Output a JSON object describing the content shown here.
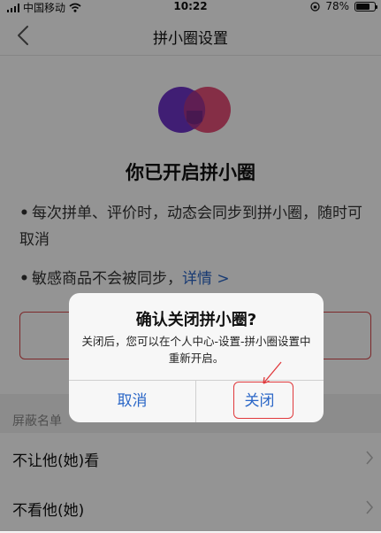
{
  "status_bar": {
    "carrier": "中国移动",
    "time": "10:22",
    "battery": "78%",
    "battery_level": 0.78,
    "icons": [
      "signal-icon",
      "wifi-icon",
      "orientation-lock-icon",
      "battery-icon"
    ]
  },
  "nav": {
    "title": "拼小圈设置",
    "back_icon": "chevron-left-icon"
  },
  "content": {
    "title": "你已开启拼小圈",
    "bullet1": "每次拼单、评价时，动态会同步到拼小圈，随时可取消",
    "bullet2_text": "敏感商品不会被同步，",
    "bullet2_link": "详情 >",
    "bullet_symbol": "•",
    "section_header": "屏蔽名单",
    "list": [
      {
        "label": "不让他(她)看"
      },
      {
        "label": "不看他(她)"
      }
    ]
  },
  "dialog": {
    "title": "确认关闭拼小圈?",
    "message": "关闭后，您可以在个人中心-设置-拼小圈设置中重新开启。",
    "cancel_label": "取消",
    "confirm_label": "关闭"
  },
  "colors": {
    "link": "#2b67c7",
    "logo_purple": "#6f34c9",
    "logo_pink": "#e23d6a",
    "highlight": "#e0393c"
  }
}
